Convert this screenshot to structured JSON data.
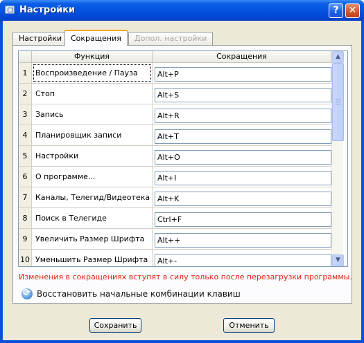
{
  "window": {
    "title": "Настройки",
    "help_label": "?",
    "close_label": "✕"
  },
  "tabs": [
    {
      "label": "Настройки",
      "state": "normal"
    },
    {
      "label": "Сокращения",
      "state": "active"
    },
    {
      "label": "Допол. настройки",
      "state": "disabled"
    }
  ],
  "table": {
    "headers": {
      "num": "",
      "function": "Функция",
      "shortcut": "Сокращения"
    },
    "rows": [
      {
        "num": "1",
        "function": "Воспроизведение / Пауза",
        "shortcut": "Alt+P"
      },
      {
        "num": "2",
        "function": "Стоп",
        "shortcut": "Alt+S"
      },
      {
        "num": "3",
        "function": "Запись",
        "shortcut": "Alt+R"
      },
      {
        "num": "4",
        "function": "Планировщик записи",
        "shortcut": "Alt+T"
      },
      {
        "num": "5",
        "function": "Настройки",
        "shortcut": "Alt+O"
      },
      {
        "num": "6",
        "function": "О программе...",
        "shortcut": "Alt+I"
      },
      {
        "num": "7",
        "function": "Каналы, Телегид/Видеотека",
        "shortcut": "Alt+K"
      },
      {
        "num": "8",
        "function": "Поиск в Телегиде",
        "shortcut": "Ctrl+F"
      },
      {
        "num": "9",
        "function": "Увеличить Размер Шрифта",
        "shortcut": "Alt++"
      },
      {
        "num": "10",
        "function": "Уменьшить Размер Шрифта",
        "shortcut": "Alt+-"
      }
    ]
  },
  "scrollbar": {
    "up": "▲",
    "down": "▼"
  },
  "warning_text": "Изменения в сокращениях вступят в силу только после перезагрузки программы.",
  "restore_label": "Восстановить начальные комбинации клавиш",
  "buttons": {
    "save": "Сохранить",
    "cancel": "Отменить"
  },
  "colors": {
    "warning": "#e0220c",
    "titlebar": "#0553e0",
    "active_tab_accent": "#f5a623"
  }
}
